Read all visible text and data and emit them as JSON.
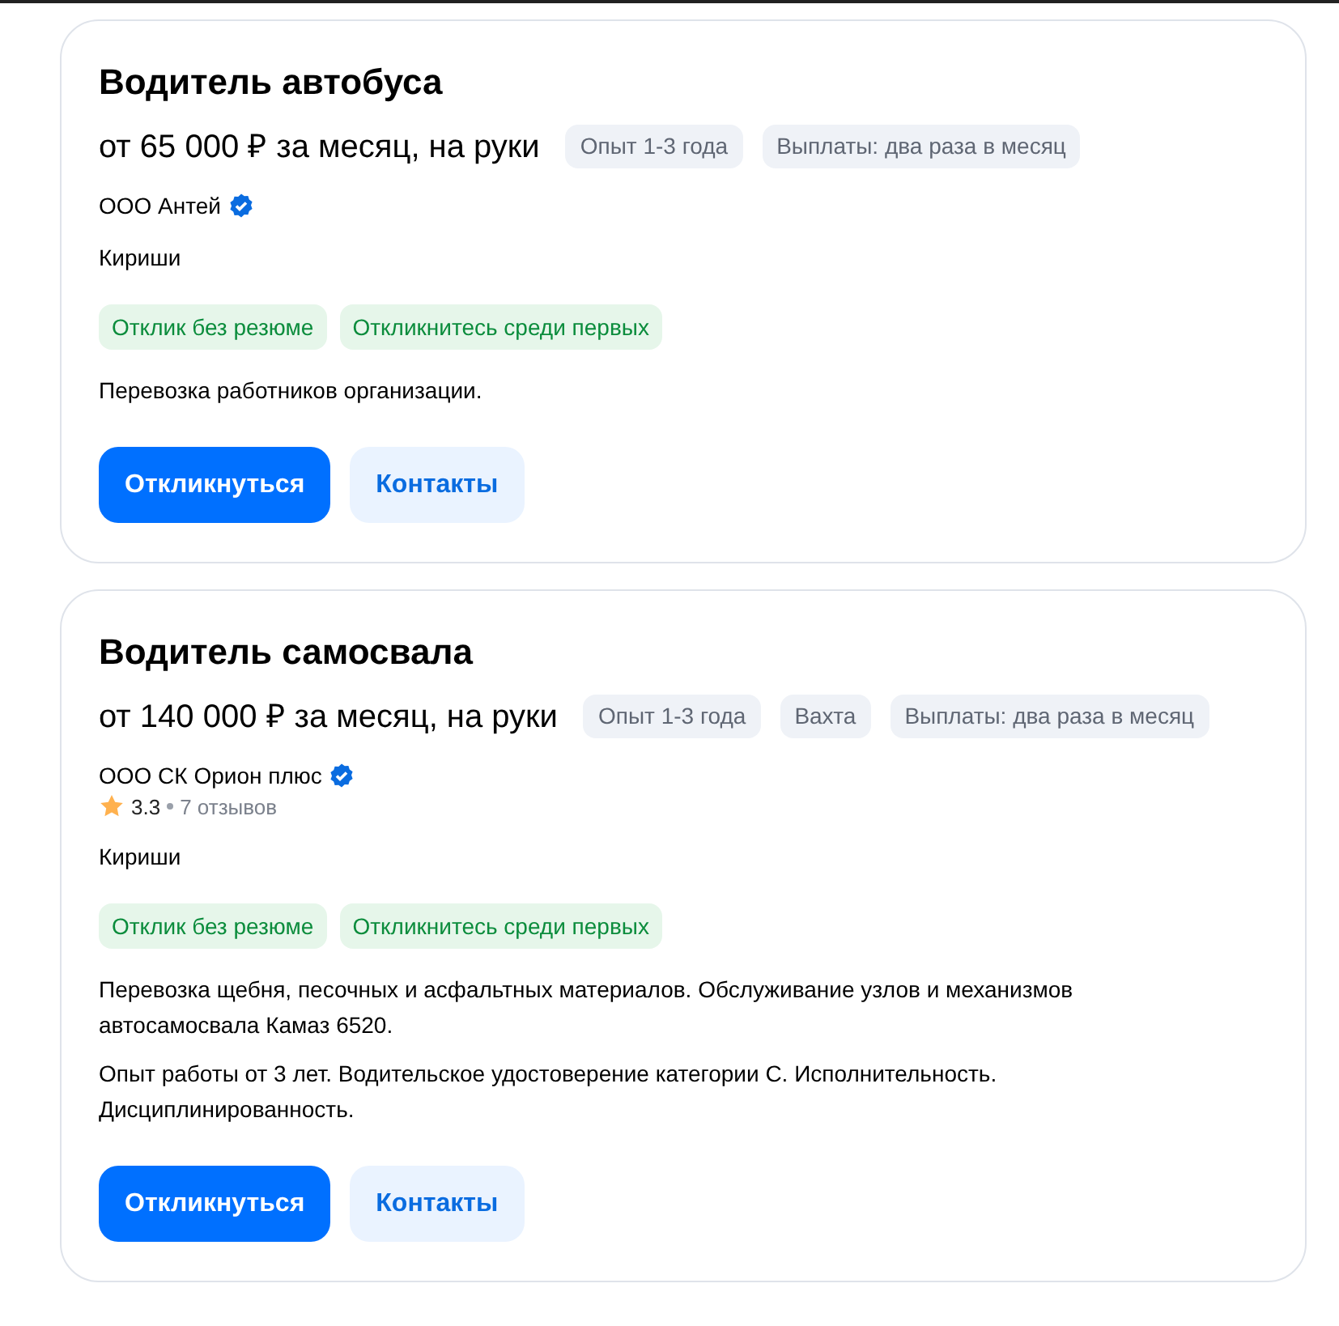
{
  "vacancies": [
    {
      "title": "Водитель автобуса",
      "salary": "от 65 000 ₽ за месяц, на руки",
      "chips": [
        "Опыт 1-3 года",
        "Выплаты: два раза в месяц"
      ],
      "company": "ООО Антей",
      "verified": true,
      "city": "Кириши",
      "tags": [
        "Отклик без резюме",
        "Откликнитесь среди первых"
      ],
      "description": [
        "Перевозка работников организации."
      ],
      "buttons": [
        {
          "kind": "primary",
          "label": "Откликнуться"
        },
        {
          "kind": "secondary",
          "label": "Контакты"
        }
      ]
    },
    {
      "title": "Водитель самосвала",
      "salary": "от 140 000 ₽ за месяц, на руки",
      "chips": [
        "Опыт 1-3 года",
        "Вахта",
        "Выплаты: два раза в месяц"
      ],
      "company": "ООО СК Орион плюс",
      "verified": true,
      "rating": {
        "score": "3.3",
        "reviews": "7 отзывов"
      },
      "city": "Кириши",
      "tags": [
        "Отклик без резюме",
        "Откликнитесь среди первых"
      ],
      "description": [
        "Перевозка щебня, песочных и асфальтных материалов. Обслуживание узлов и механизмов автосамосвала Камаз 6520.",
        "Опыт работы от 3 лет. Водительское удостоверение категории С. Исполнительность. Дисциплинированность."
      ],
      "buttons": [
        {
          "kind": "primary",
          "label": "Откликнуться"
        },
        {
          "kind": "secondary",
          "label": "Контакты"
        }
      ]
    }
  ]
}
